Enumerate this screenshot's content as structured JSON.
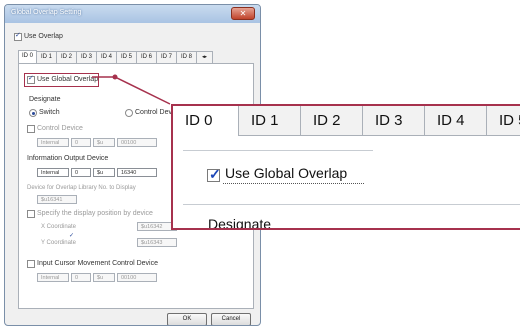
{
  "window": {
    "title": "Global Overlap Setting",
    "close_symbol": "✕"
  },
  "use_overlap": {
    "label": "Use Overlap",
    "checked": true
  },
  "tabs": [
    "ID 0",
    "ID 1",
    "ID 2",
    "ID 3",
    "ID 4",
    "ID 5",
    "ID 6",
    "ID 7",
    "ID 8"
  ],
  "active_tab": "ID 0",
  "panel": {
    "use_global_overlap": {
      "label": "Use Global Overlap",
      "checked": true
    },
    "designate": {
      "heading": "Designate",
      "option_switch": "Switch",
      "option_control_device": "Control Device"
    },
    "control_device": {
      "label": "Control Device",
      "type": "Internal",
      "index": "0",
      "prefix": "$u",
      "address": "00100"
    },
    "info_output": {
      "label": "Information Output Device",
      "type": "Internal",
      "index": "0",
      "prefix": "$u",
      "address": "16340"
    },
    "library_device": {
      "label": "Device for Overlap Library No. to Display",
      "value": "$u16341"
    },
    "display_position": {
      "label": "Specify the display position by device",
      "x_label": "X Coordinate",
      "x_value": "$u16342",
      "y_label": "Y Coordinate",
      "y_value": "$u16343"
    },
    "cursor_movement": {
      "label": "Input Cursor Movement Control Device",
      "type": "Internal",
      "index": "0",
      "prefix": "$u",
      "address": "00100"
    }
  },
  "buttons": {
    "ok": "OK",
    "cancel": "Cancel"
  },
  "zoom": {
    "tabs": [
      "ID 0",
      "ID 1",
      "ID 2",
      "ID 3",
      "ID 4",
      "ID 5"
    ],
    "checkbox_label": "Use Global Overlap",
    "designate": "Designate"
  },
  "colors": {
    "highlight": "#a6314d",
    "titlebar": "#a9c3e3"
  }
}
